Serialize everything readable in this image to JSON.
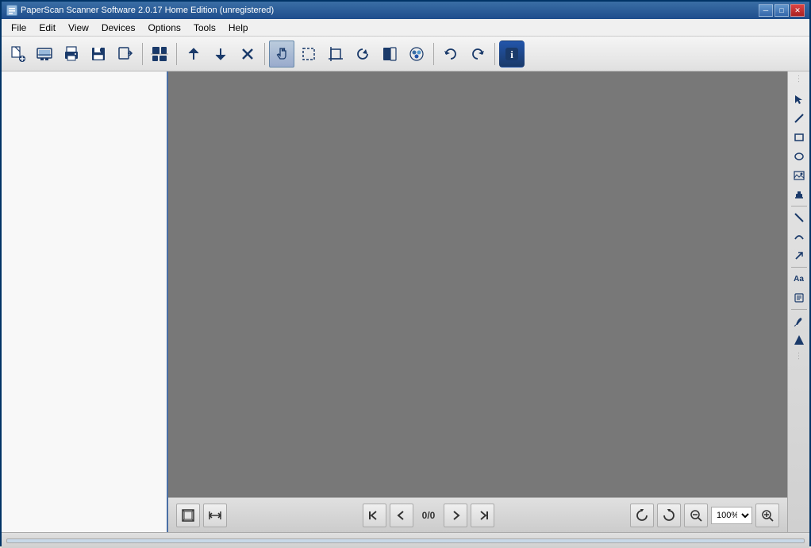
{
  "titleBar": {
    "title": "PaperScan Scanner Software 2.0.17 Home Edition (unregistered)",
    "icon": "P",
    "minimizeLabel": "─",
    "maximizeLabel": "□",
    "closeLabel": "✕"
  },
  "menuBar": {
    "items": [
      {
        "id": "file",
        "label": "File"
      },
      {
        "id": "edit",
        "label": "Edit"
      },
      {
        "id": "view",
        "label": "View"
      },
      {
        "id": "devices",
        "label": "Devices"
      },
      {
        "id": "options",
        "label": "Options"
      },
      {
        "id": "tools",
        "label": "Tools"
      },
      {
        "id": "help",
        "label": "Help"
      }
    ]
  },
  "toolbar": {
    "groups": [
      {
        "buttons": [
          {
            "id": "new",
            "icon": "⊕",
            "tooltip": "New"
          },
          {
            "id": "scan",
            "icon": "⊞",
            "tooltip": "Scan"
          },
          {
            "id": "print",
            "icon": "⎙",
            "tooltip": "Print"
          },
          {
            "id": "save",
            "icon": "💾",
            "tooltip": "Save"
          },
          {
            "id": "export",
            "icon": "⊡",
            "tooltip": "Export"
          }
        ]
      },
      {
        "buttons": [
          {
            "id": "layout",
            "icon": "▦",
            "tooltip": "Layout"
          }
        ]
      },
      {
        "buttons": [
          {
            "id": "up",
            "icon": "▲",
            "tooltip": "Move Up"
          },
          {
            "id": "down",
            "icon": "▼",
            "tooltip": "Move Down"
          },
          {
            "id": "delete",
            "icon": "✕",
            "tooltip": "Delete"
          }
        ]
      },
      {
        "buttons": [
          {
            "id": "hand",
            "icon": "✋",
            "tooltip": "Hand Tool",
            "active": true
          },
          {
            "id": "select",
            "icon": "⬚",
            "tooltip": "Selection"
          },
          {
            "id": "crop",
            "icon": "⊠",
            "tooltip": "Crop"
          },
          {
            "id": "rotate",
            "icon": "↻",
            "tooltip": "Rotate"
          },
          {
            "id": "brightness",
            "icon": "◧",
            "tooltip": "Brightness"
          },
          {
            "id": "color",
            "icon": "◉",
            "tooltip": "Color"
          }
        ]
      },
      {
        "buttons": [
          {
            "id": "undo",
            "icon": "↶",
            "tooltip": "Undo"
          },
          {
            "id": "redo",
            "icon": "↷",
            "tooltip": "Redo"
          }
        ]
      },
      {
        "buttons": [
          {
            "id": "info",
            "icon": "ℹ",
            "tooltip": "Info"
          }
        ]
      }
    ]
  },
  "rightToolbar": {
    "tools": [
      {
        "id": "pointer",
        "icon": "↖",
        "tooltip": "Pointer"
      },
      {
        "id": "line",
        "icon": "╱",
        "tooltip": "Line"
      },
      {
        "id": "rectangle",
        "icon": "▭",
        "tooltip": "Rectangle"
      },
      {
        "id": "ellipse",
        "icon": "⬭",
        "tooltip": "Ellipse"
      },
      {
        "id": "image",
        "icon": "⊞",
        "tooltip": "Image"
      },
      {
        "id": "stamp",
        "icon": "⬆",
        "tooltip": "Stamp"
      },
      {
        "id": "diagonal-line",
        "icon": "╲",
        "tooltip": "Diagonal Line"
      },
      {
        "id": "curve",
        "icon": "⌒",
        "tooltip": "Curve"
      },
      {
        "id": "arrow",
        "icon": "↗",
        "tooltip": "Arrow"
      },
      {
        "id": "text",
        "icon": "Aa",
        "tooltip": "Text"
      },
      {
        "id": "note",
        "icon": "≡",
        "tooltip": "Note"
      },
      {
        "id": "pen",
        "icon": "✒",
        "tooltip": "Pen"
      },
      {
        "id": "shape",
        "icon": "◆",
        "tooltip": "Shape"
      }
    ]
  },
  "canvasBottom": {
    "fitPage": "⊞",
    "fitWidth": "⊟",
    "prevFirst": "⏮",
    "prev": "◀",
    "pageIndicator": "0/0",
    "next": "▶",
    "nextLast": "⏭",
    "rotateLeft": "↺",
    "rotateRight": "↻",
    "zoomOut": "🔍",
    "zoomValue": "100%",
    "zoomIn": "🔍"
  },
  "statusBar": {
    "text": ""
  }
}
